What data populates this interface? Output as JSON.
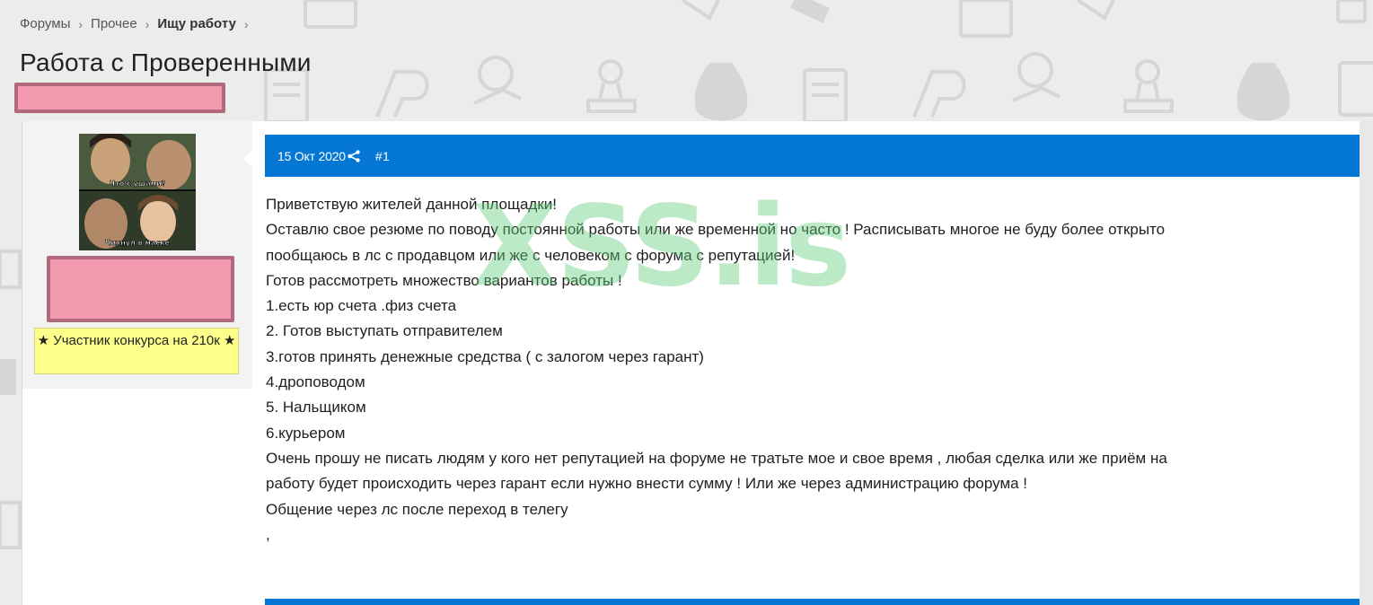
{
  "breadcrumb": {
    "items": [
      "Форумы",
      "Прочее",
      "Ищу работу"
    ],
    "separator": "›"
  },
  "thread": {
    "title": "Работа с Проверенными"
  },
  "user": {
    "badge": "★ Участник конкурса на 210к ★",
    "avatar_caption_top": "Что с ушами?",
    "avatar_caption_bottom": "Чихнул в маске"
  },
  "post": {
    "date": "15 Окт 2020",
    "number": "#1",
    "lines": [
      "Приветствую жителей данной площадки!",
      "Оставлю свое резюме по поводу постоянной работы или же временной но часто ! Расписывать многое не буду более открыто",
      "пообщаюсь в лс с продавцом или же с человеком с форума с репутацией!",
      "Готов рассмотреть множество вариантов работы !",
      "1.есть юр счета .физ счета",
      "2. Готов выступать отправителем",
      "3.готов принять денежные средства ( с залогом через гарант)",
      "4.дроповодом",
      "5. Нальщиком",
      "6.курьером",
      "Очень прошу не писать людям у кого нет репутацией на форуме не тратьте мое и свое время , любая сделка или же приём на",
      "работу будет происходить через гарант если нужно внести сумму ! Или же через администрацию форума !",
      "Общение через лс после переход в телегу",
      ","
    ]
  },
  "watermark": "XSS.is",
  "colors": {
    "accent": "#0477d5",
    "badge_bg": "#ffff8c",
    "redaction": "#f49ab0",
    "watermark": "#5fcd78"
  },
  "icons": [
    "share-icon",
    "chevron-right-icon"
  ]
}
